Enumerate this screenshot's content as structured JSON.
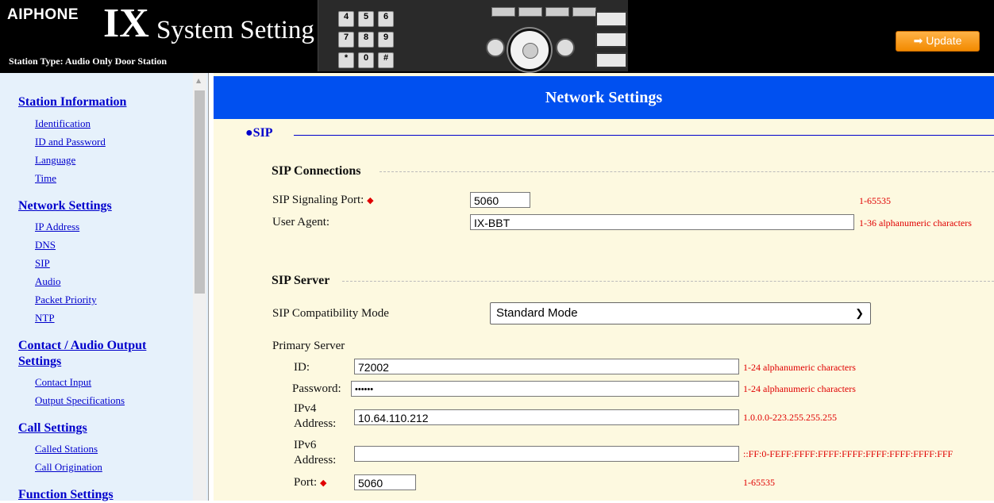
{
  "header": {
    "brand": "AIPHONE",
    "ix": "IX",
    "title": "System Setting",
    "station_type": "Station Type: Audio Only Door Station",
    "update_label": "➡ Update",
    "keys": [
      "4",
      "5",
      "6",
      "7",
      "8",
      "9",
      "*",
      "0",
      "#"
    ]
  },
  "sidebar": {
    "sections": [
      {
        "title": "Station Information",
        "items": [
          "Identification",
          "ID and Password",
          "Language",
          "Time"
        ]
      },
      {
        "title": "Network Settings",
        "items": [
          "IP Address",
          "DNS",
          "SIP",
          "Audio",
          "Packet Priority",
          "NTP"
        ]
      },
      {
        "title_line1": "Contact / Audio Output",
        "title_line2": "Settings",
        "items": [
          "Contact Input",
          "Output Specifications"
        ]
      },
      {
        "title": "Call Settings",
        "items": [
          "Called Stations",
          "Call Origination"
        ]
      },
      {
        "title": "Function Settings"
      }
    ]
  },
  "main": {
    "banner": "Network Settings",
    "sip_title": "●SIP",
    "sip_connections": {
      "title": "SIP Connections",
      "signaling_port_label": "SIP Signaling Port:",
      "signaling_port_value": "5060",
      "signaling_port_hint": "1-65535",
      "user_agent_label": "User Agent:",
      "user_agent_value": "IX-BBT",
      "user_agent_hint": "1-36 alphanumeric characters"
    },
    "sip_server": {
      "title": "SIP Server",
      "compat_label": "SIP Compatibility Mode",
      "compat_value": "Standard Mode",
      "primary_label": "Primary Server",
      "id_label": "ID:",
      "id_value": "72002",
      "id_hint": "1-24 alphanumeric characters",
      "password_label": "Password:",
      "password_value": "••••••",
      "password_hint": "1-24 alphanumeric characters",
      "ipv4_label_1": "IPv4",
      "ipv4_label_2": "Address:",
      "ipv4_value": "10.64.110.212",
      "ipv4_hint": "1.0.0.0-223.255.255.255",
      "ipv6_label_1": "IPv6",
      "ipv6_label_2": "Address:",
      "ipv6_value": "",
      "ipv6_hint": "::FF:0-FEFF:FFFF:FFFF:FFFF:FFFF:FFFF:FFFF:FFF",
      "port_label": "Port:",
      "port_value": "5060",
      "port_hint": "1-65535"
    }
  },
  "colors": {
    "banner": "#0050f0",
    "link": "#0000cc",
    "hint": "#e00000",
    "content_bg": "#fdf9e0",
    "sidebar_bg": "#e6f1fb",
    "update": "#f28a00"
  }
}
